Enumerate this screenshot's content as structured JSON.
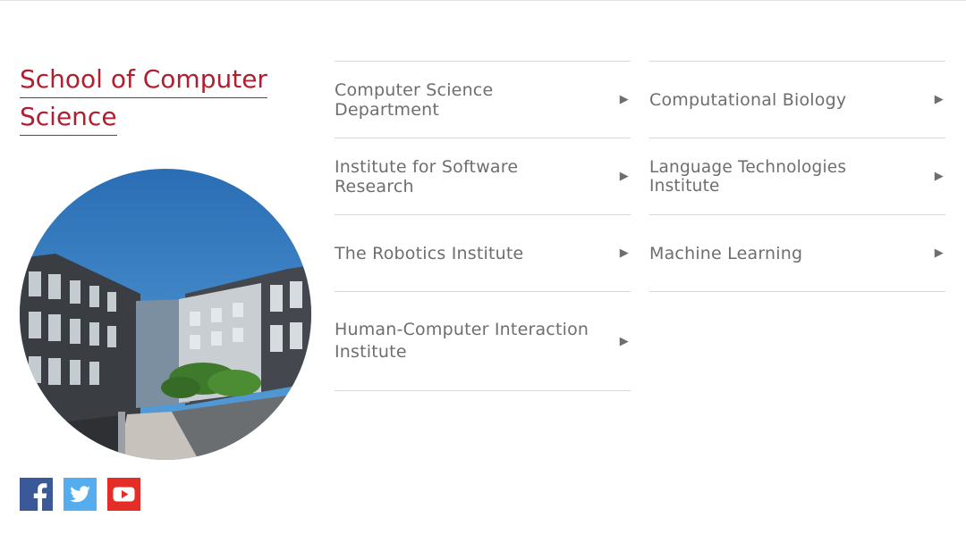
{
  "school": {
    "title_line1": "School of Computer",
    "title_line2": "Science"
  },
  "departments": {
    "left": [
      {
        "label": "Computer Science Department",
        "arrow": "▶"
      },
      {
        "label": "Institute for Software Research",
        "arrow": "▶"
      },
      {
        "label": "The Robotics Institute",
        "arrow": "▶"
      },
      {
        "label": "Human-Computer Interaction Institute",
        "arrow": "▶"
      }
    ],
    "right": [
      {
        "label": "Computational Biology",
        "arrow": "▶"
      },
      {
        "label": "Language Technologies Institute",
        "arrow": "▶"
      },
      {
        "label": "Machine Learning",
        "arrow": "▶"
      }
    ]
  },
  "social": [
    {
      "name": "facebook-icon",
      "color": "#3b5998"
    },
    {
      "name": "twitter-icon",
      "color": "#55acee"
    },
    {
      "name": "youtube-icon",
      "color": "#e52d27"
    }
  ],
  "colors": {
    "accent": "#b01e2f",
    "divider": "#d8d8d8",
    "text": "#6e6e6e"
  }
}
